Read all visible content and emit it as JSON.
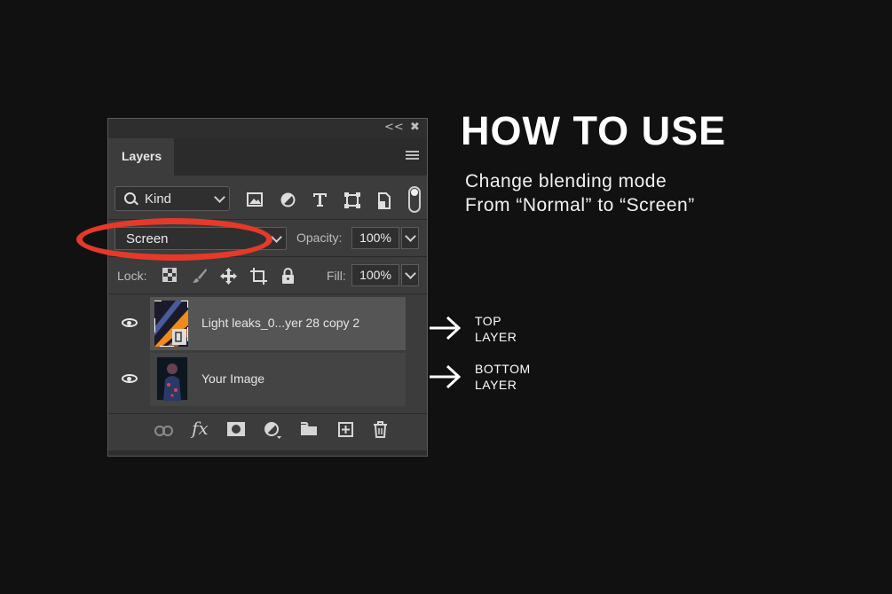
{
  "panel": {
    "tab_label": "Layers",
    "filter_kind": "Kind",
    "blend_mode": "Screen",
    "opacity_label": "Opacity:",
    "opacity_value": "100%",
    "lock_label": "Lock:",
    "fill_label": "Fill:",
    "fill_value": "100%",
    "collapse_icon": "<<",
    "close_icon": "✖",
    "layers": [
      {
        "name": "Light leaks_0...yer 28 copy 2",
        "selected": true,
        "visible": true
      },
      {
        "name": "Your Image",
        "selected": false,
        "visible": true
      }
    ]
  },
  "instructions": {
    "title": "HOW TO USE",
    "line1": "Change blending mode",
    "line2": "From “Normal” to “Screen”"
  },
  "annotations": {
    "top_line1": "TOP",
    "top_line2": "LAYER",
    "bottom_line1": "BOTTOM",
    "bottom_line2": "LAYER"
  },
  "colors": {
    "background": "#111111",
    "panel": "#3c3c3c",
    "highlight_oval": "#e5392a"
  }
}
